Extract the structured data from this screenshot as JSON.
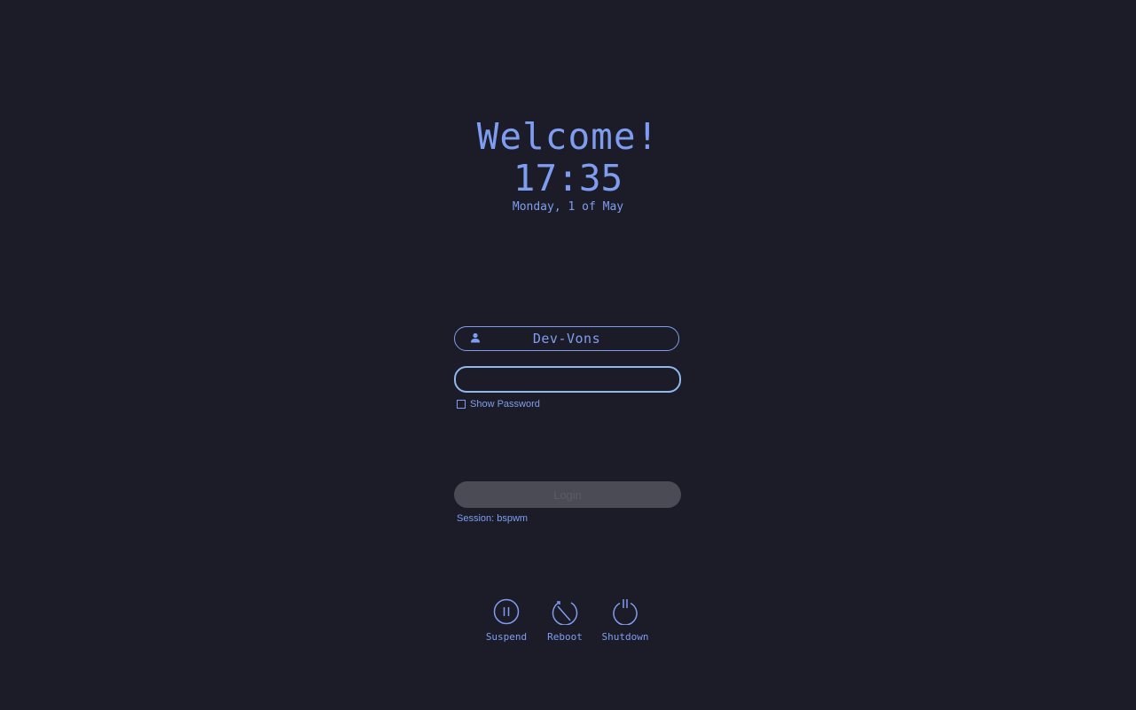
{
  "header": {
    "welcome": "Welcome!",
    "time": "17:35",
    "date": "Monday, 1 of May"
  },
  "login": {
    "username": "Dev-Vons",
    "password_value": "",
    "show_password_label": "Show Password",
    "login_button_label": "Login",
    "session_label": "Session: bspwm"
  },
  "power": {
    "suspend_label": "Suspend",
    "reboot_label": "Reboot",
    "shutdown_label": "Shutdown"
  },
  "icons": {
    "user": "user-icon",
    "suspend": "pause-icon",
    "reboot": "reboot-icon",
    "shutdown": "power-icon"
  },
  "colors": {
    "background": "#1c1c28",
    "accent": "#7f9df0",
    "focus": "#8fb8ee",
    "button_disabled": "#4a4b54"
  }
}
